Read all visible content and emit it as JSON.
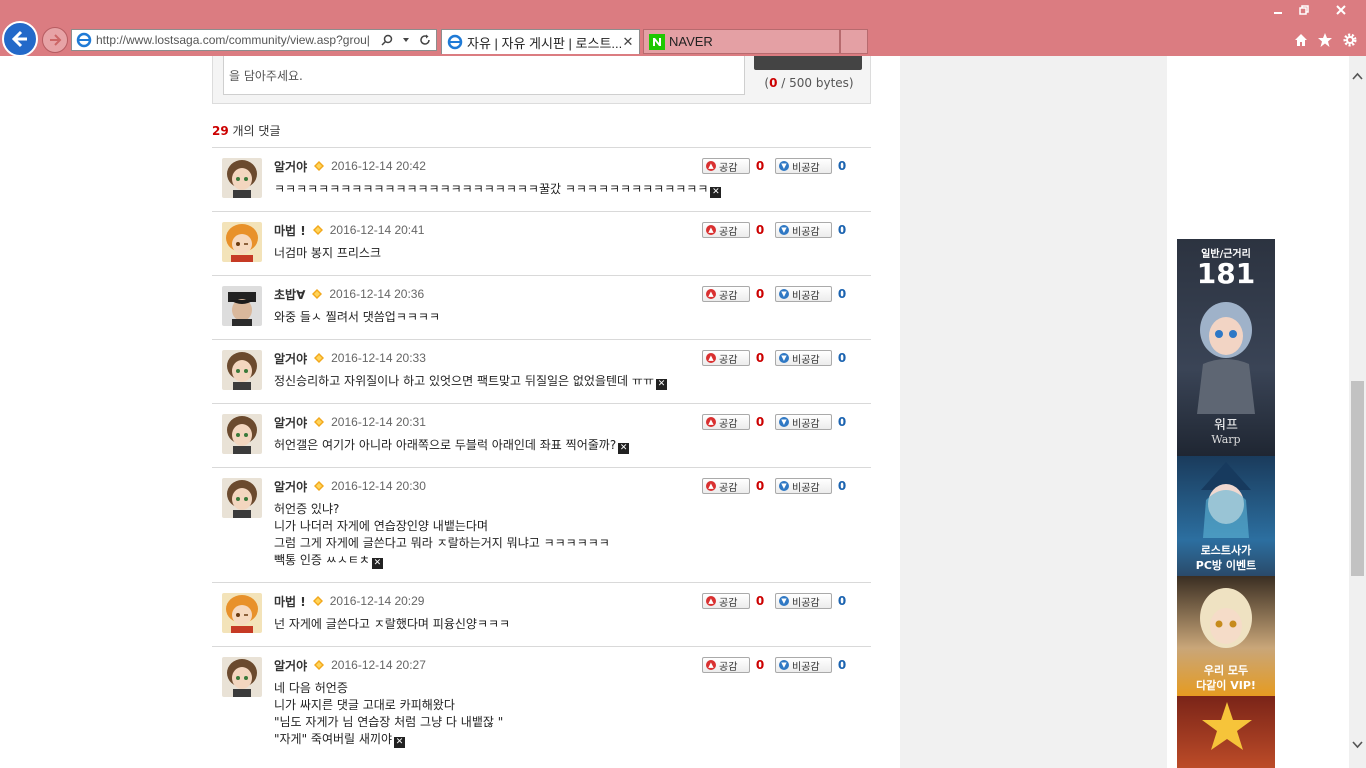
{
  "browser": {
    "url": "http://www.lostsaga.com/community/view.asp?grou|",
    "tabs": [
      {
        "label": "자유 | 자유 게시판 | 로스트...",
        "active": true
      },
      {
        "label": "NAVER",
        "active": false
      }
    ],
    "colors": {
      "chrome": "#db7c81",
      "back_button": "#2369c9"
    }
  },
  "form": {
    "textarea_text": "을 담아주세요.",
    "byte_count": "0",
    "byte_suffix": " / 500 bytes)",
    "byte_prefix": "("
  },
  "comment_count": {
    "number": "29",
    "suffix": " 개의 댓글"
  },
  "vote_labels": {
    "up": "공감",
    "down": "비공감"
  },
  "comments": [
    {
      "nick": "알거야",
      "date": "2016-12-14 20:42",
      "lines": [
        "ㅋㅋㅋㅋㅋㅋㅋㅋㅋㅋㅋㅋㅋㅋㅋㅋㅋㅋㅋㅋㅋㅋㅋㅋ꿀갔 ㅋㅋㅋㅋㅋㅋㅋㅋㅋㅋㅋㅋㅋ"
      ],
      "up": "0",
      "down": "0",
      "avatar": "brown-hair-icon",
      "has_x": true
    },
    {
      "nick": "마법 !",
      "date": "2016-12-14 20:41",
      "lines": [
        "너검마 봉지 프리스크"
      ],
      "up": "0",
      "down": "0",
      "avatar": "orange-hair-icon",
      "has_x": false
    },
    {
      "nick": "초밥∀",
      "date": "2016-12-14 20:36",
      "lines": [
        "와중 들ㅅ 찔려서 댓씀업ㅋㅋㅋㅋ"
      ],
      "up": "0",
      "down": "0",
      "avatar": "dark-hat-icon",
      "has_x": false
    },
    {
      "nick": "알거야",
      "date": "2016-12-14 20:33",
      "lines": [
        "정신승리하고 자위질이나 하고 있엇으면 팩트맞고 뒤질일은 없었을텐데 ㅠㅠ"
      ],
      "up": "0",
      "down": "0",
      "avatar": "brown-hair-icon",
      "has_x": true
    },
    {
      "nick": "알거야",
      "date": "2016-12-14 20:31",
      "lines": [
        "허언갤은 여기가 아니라 아래쪽으로 두블럭 아래인데 좌표 찍어줄까?"
      ],
      "up": "0",
      "down": "0",
      "avatar": "brown-hair-icon",
      "has_x": true
    },
    {
      "nick": "알거야",
      "date": "2016-12-14 20:30",
      "lines": [
        "허언증 있냐?",
        "니가 나더러 자게에 연습장인양 내뱉는다며",
        "그럼 그게 자게에 글쓴다고 뭐라 ㅈ랄하는거지 뭐냐고 ㅋㅋㅋㅋㅋㅋ",
        "빽통 인증 ㅆㅅㅌㅊ"
      ],
      "up": "0",
      "down": "0",
      "avatar": "brown-hair-icon",
      "has_x": true
    },
    {
      "nick": "마법 !",
      "date": "2016-12-14 20:29",
      "lines": [
        "넌 자게에 글쓴다고 ㅈ랄했다며 피융신양ㅋㅋㅋ"
      ],
      "up": "0",
      "down": "0",
      "avatar": "orange-hair-icon",
      "has_x": false
    },
    {
      "nick": "알거야",
      "date": "2016-12-14 20:27",
      "lines": [
        "네 다음 허언증",
        "니가 싸지른 댓글 고대로 카피해왔다",
        "\"님도 자게가 님 연습장 처럼 그냥 다 내뱉잖 \"",
        "\"자게\" 죽여버릴 새끼야"
      ],
      "up": "0",
      "down": "0",
      "avatar": "brown-hair-icon",
      "has_x": true
    }
  ],
  "ads": {
    "ad1": {
      "top": "일반/근거리",
      "num": "181",
      "name_ko": "워프",
      "name_en": "Warp"
    },
    "ad2": {
      "line1": "로스트사가",
      "line2": "PC방 이벤트"
    },
    "ad3": {
      "line1": "우리 모두",
      "line2": "다같이 VIP!"
    }
  }
}
